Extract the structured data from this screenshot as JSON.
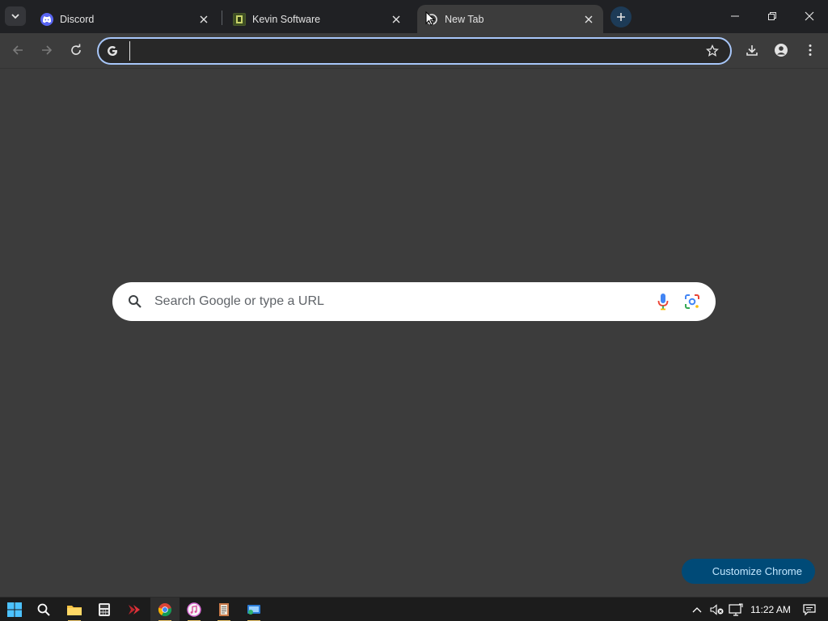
{
  "browser": {
    "tabs": [
      {
        "title": "Discord",
        "favicon": "discord-icon",
        "active": false
      },
      {
        "title": "Kevin Software",
        "favicon": "kevin-software-icon",
        "active": false
      },
      {
        "title": "New Tab",
        "favicon": "chrome-newtab-icon",
        "active": true
      }
    ],
    "toolbar": {
      "omnibox_value": "",
      "omnibox_placeholder": ""
    }
  },
  "newtab": {
    "search_placeholder": "Search Google or type a URL",
    "customize_label": "Customize Chrome"
  },
  "taskbar": {
    "apps": [
      "start-icon",
      "search-icon",
      "file-explorer-icon",
      "calculator-icon",
      "red-app-icon",
      "chrome-icon",
      "itunes-icon",
      "notepad-icon",
      "remote-app-icon"
    ],
    "active_app": "chrome-icon",
    "clock": "11:22 AM"
  },
  "colors": {
    "content_bg": "#3c3c3c",
    "tabstrip_bg": "#202124",
    "omnibox_focus": "#a8c7fa",
    "customize_bg": "#004a77"
  }
}
